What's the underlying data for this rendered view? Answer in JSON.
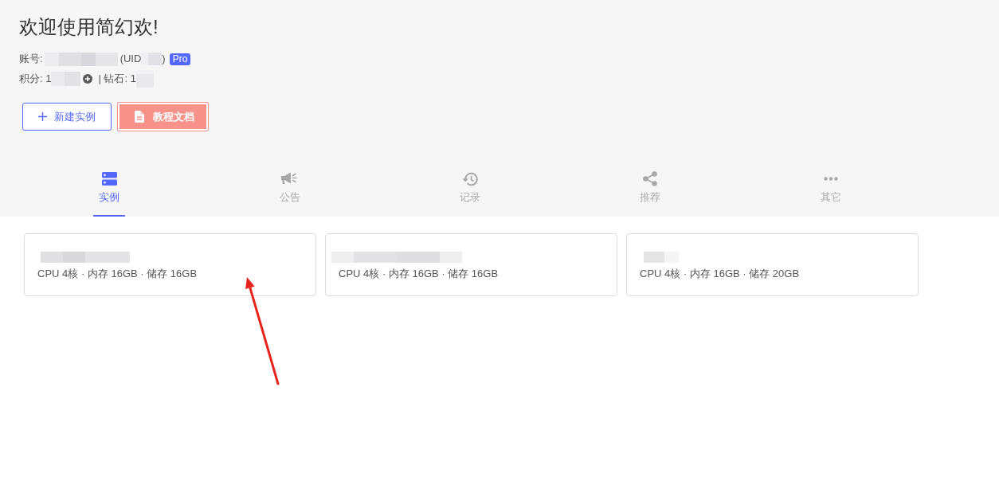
{
  "header": {
    "title": "欢迎使用简幻欢!",
    "account": {
      "label": "账号:",
      "uid_open": "(UID",
      "uid_close": ")",
      "badge": "Pro"
    },
    "balance": {
      "points_label": "积分: 1",
      "diamonds_label": "| 钻石: 1"
    }
  },
  "buttons": [
    {
      "kind": "outline",
      "label": "新建实例"
    },
    {
      "kind": "primary",
      "label": "教程文档"
    }
  ],
  "tabs": [
    {
      "label": "实例",
      "selected": true
    },
    {
      "label": "公告",
      "selected": false
    },
    {
      "label": "记录",
      "selected": false
    },
    {
      "label": "推荐",
      "selected": false
    },
    {
      "label": "其它",
      "selected": false
    }
  ],
  "instances": [
    {
      "spec": "CPU 4核 · 内存 16GB · 储存 16GB"
    },
    {
      "spec": "CPU 4核 · 内存 16GB · 储存 16GB"
    },
    {
      "spec": "CPU 4核 · 内存 16GB · 储存 20GB"
    }
  ]
}
